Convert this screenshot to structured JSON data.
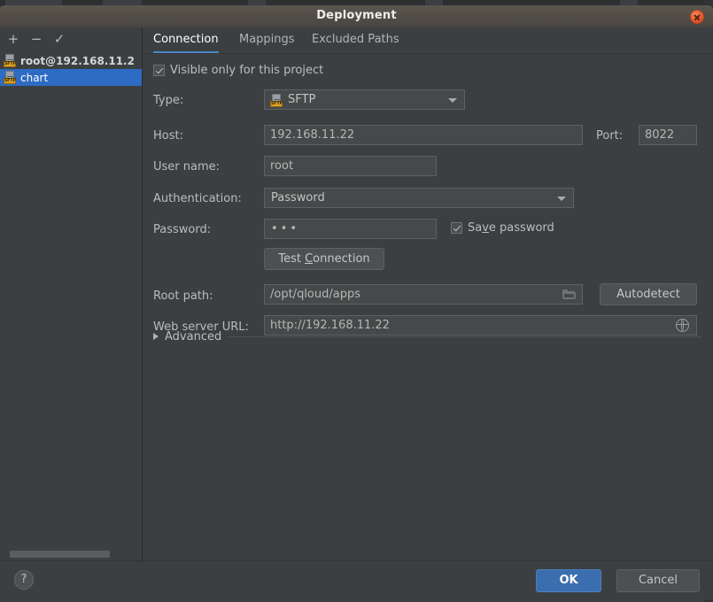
{
  "window": {
    "title": "Deployment",
    "close_icon": "close-icon"
  },
  "sidebar": {
    "toolbar": [
      {
        "name": "add-server-button",
        "glyph": "+"
      },
      {
        "name": "remove-server-button",
        "glyph": "−"
      },
      {
        "name": "use-as-default-button",
        "glyph": "✓"
      }
    ],
    "items": [
      {
        "label": "root@192.168.11.2",
        "icon": "sftp-icon",
        "icon_text": "SFTP",
        "selected": false
      },
      {
        "label": "chart",
        "icon": "sftp-icon",
        "icon_text": "SFTP",
        "selected": true
      }
    ]
  },
  "main": {
    "tabs": [
      {
        "label": "Connection",
        "active": true
      },
      {
        "label": "Mappings",
        "active": false
      },
      {
        "label": "Excluded Paths",
        "active": false
      }
    ],
    "visible_only_checkbox": {
      "label": "Visible only for this project",
      "checked": true
    },
    "fields": {
      "type_label": "Type:",
      "type_value": "SFTP",
      "type_icon_text": "SFTP",
      "host_label": "Host:",
      "host_value": "192.168.11.22",
      "port_label": "Port:",
      "port_value": "8022",
      "username_label": "User name:",
      "username_value": "root",
      "auth_label": "Authentication:",
      "auth_value": "Password",
      "password_label": "Password:",
      "password_value": "•••",
      "save_password_label_pre": "Sa",
      "save_password_label_mnemonic": "v",
      "save_password_label_post": "e password",
      "save_password_checked": true,
      "test_connection_pre": "Test ",
      "test_connection_mnemonic": "C",
      "test_connection_post": "onnection",
      "root_path_label": "Root path:",
      "root_path_value": "/opt/qloud/apps",
      "root_path_browse_icon": "folder-icon",
      "autodetect_label": "Autodetect",
      "web_server_url_label": "Web server URL:",
      "web_server_url_value": "http://192.168.11.22",
      "web_server_url_icon": "globe-icon"
    },
    "advanced_label": "Advanced"
  },
  "footer": {
    "help_label": "?",
    "ok_label": "OK",
    "cancel_label": "Cancel"
  },
  "colors": {
    "accent_blue": "#4a88c7",
    "selection_blue": "#2d6bc4",
    "ok_button_blue": "#3b6eaf",
    "panel_bg": "#3c3f41",
    "field_bg": "#45494a",
    "sftp_tag_yellow": "#d9a227",
    "close_red": "#e0562c"
  }
}
